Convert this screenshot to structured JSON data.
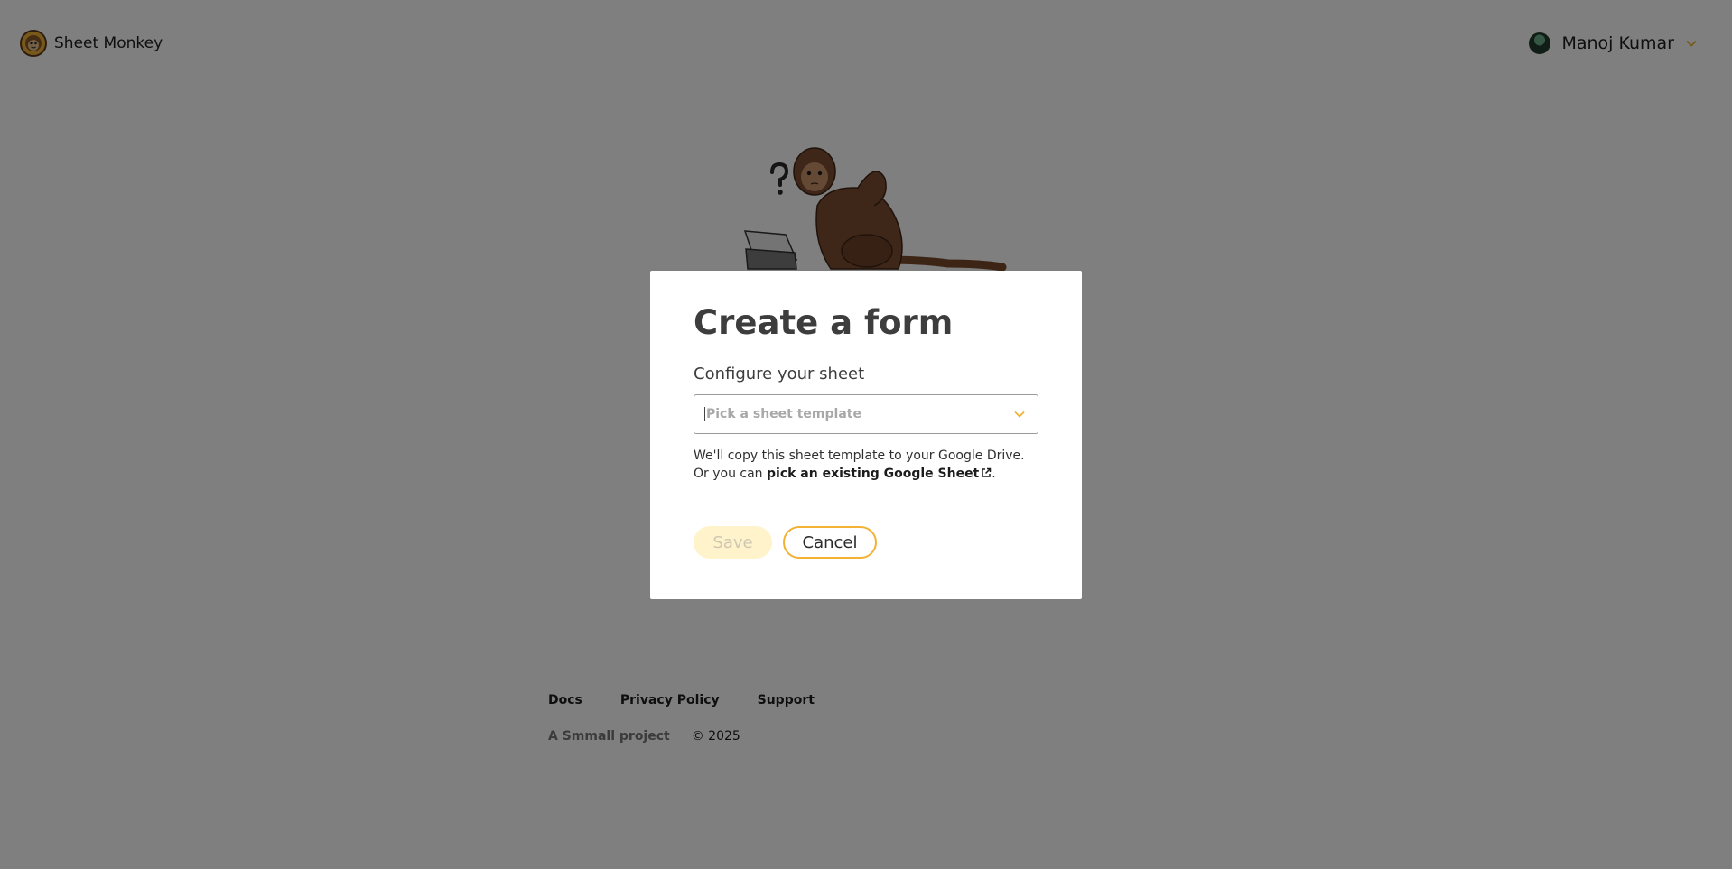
{
  "header": {
    "brand_name": "Sheet Monkey",
    "user_name": "Manoj Kumar"
  },
  "modal": {
    "title": "Create a form",
    "section_label": "Configure your sheet",
    "select_placeholder": "Pick a sheet template",
    "help_text_prefix": "We'll copy this sheet template to your Google Drive. Or you can ",
    "help_link": "pick an existing Google Sheet",
    "help_text_suffix": ".",
    "save_label": "Save",
    "cancel_label": "Cancel"
  },
  "footer": {
    "links": [
      "Docs",
      "Privacy Policy",
      "Support"
    ],
    "smmall": "A Smmall project",
    "copyright": "© 2025"
  },
  "colors": {
    "accent": "#f2b233",
    "overlay": "rgba(0,0,0,0.5)"
  },
  "icons": [
    "monkey-logo-icon",
    "chevron-down-icon",
    "external-link-icon",
    "avatar"
  ]
}
